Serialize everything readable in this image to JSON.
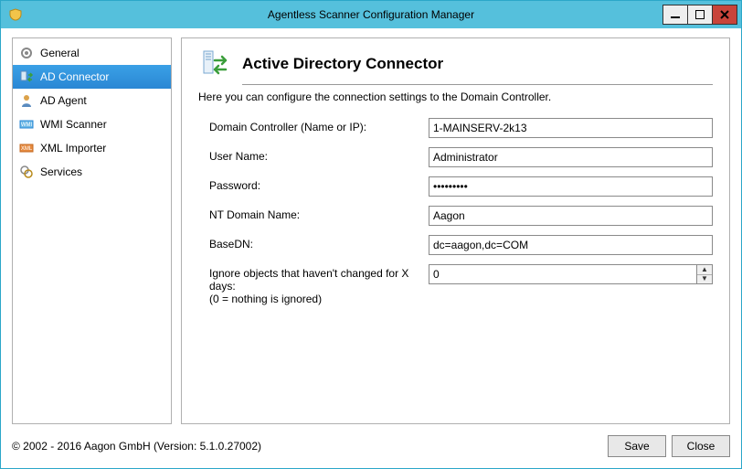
{
  "window": {
    "title": "Agentless Scanner Configuration Manager"
  },
  "sidebar": {
    "items": [
      {
        "label": "General"
      },
      {
        "label": "AD Connector"
      },
      {
        "label": "AD Agent"
      },
      {
        "label": "WMI Scanner"
      },
      {
        "label": "XML Importer"
      },
      {
        "label": "Services"
      }
    ],
    "selected_index": 1
  },
  "page": {
    "title": "Active Directory Connector",
    "description": "Here you can configure the connection settings to the Domain Controller.",
    "fields": {
      "domain_controller": {
        "label": "Domain Controller (Name or IP):",
        "value": "1-MAINSERV-2k13"
      },
      "user_name": {
        "label": "User Name:",
        "value": "Administrator"
      },
      "password": {
        "label": "Password:",
        "value": "•••••••••"
      },
      "nt_domain": {
        "label": "NT Domain Name:",
        "value": "Aagon"
      },
      "base_dn": {
        "label": "BaseDN:",
        "value": "dc=aagon,dc=COM"
      },
      "ignore_days": {
        "label": "Ignore objects that haven't changed for X days:\n(0 = nothing is ignored)",
        "value": "0"
      }
    }
  },
  "footer": {
    "copyright": "© 2002 - 2016 Aagon GmbH (Version: 5.1.0.27002)",
    "save_label": "Save",
    "close_label": "Close"
  }
}
